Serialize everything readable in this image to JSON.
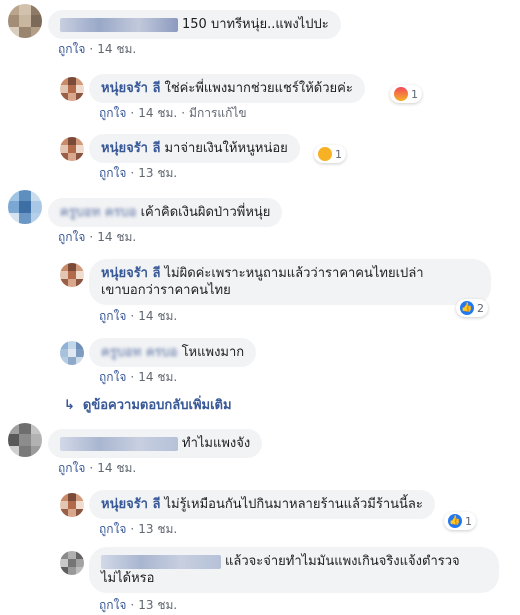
{
  "labels": {
    "like": "ถูกใจ",
    "more_replies": "ดูข้อความตอบกลับเพิ่มเติม"
  },
  "comments": [
    {
      "name": "Preeda Papang",
      "text": "150 บาทรีหนุ่ย..แพงไปปะ",
      "time": "14 ชม."
    },
    {
      "name": "หนุ่ยจรัา ลี",
      "text": "ใช่ค่ะพี่แพงมากช่วยแชร์ให้ด้วยค่ะ",
      "time": "14 ชม.",
      "edited": "มีการแก้ไข",
      "reaction": "angry",
      "count": "1"
    },
    {
      "name": "หนุ่ยจรัา ลี",
      "text": "มาจ่ายเงินให้หนูหน่อย",
      "time": "13 ชม.",
      "reaction": "haha",
      "count": "1"
    },
    {
      "name": "ครูบอท ครบอ",
      "text": "เค้าคิดเงินผิดป่าวพี่หนุ่ย",
      "time": "14 ชม."
    },
    {
      "name": "หนุ่ยจรัา ลี",
      "text1": "ไม่ผิดค่ะเพราะหนูถามแล้วว่าราคาคนไทยเปล่า",
      "text2": "เขาบอกว่าราคาคนไทย",
      "time": "14 ชม.",
      "reaction": "like",
      "count": "2"
    },
    {
      "name": "ครูบอท ครบอ",
      "text": "โหแพงมาก",
      "time": "14 ชม."
    },
    {
      "text": "ทำไมแพงจัง",
      "time": "14 ชม."
    },
    {
      "name": "หนุ่ยจรัา ลี",
      "text": "ไม่รู้เหมือนกันไปกินมาหลายร้านแล้วมีร้านนี้ละ",
      "time": "13 ชม.",
      "reaction": "like",
      "count": "1"
    },
    {
      "text1": "แล้วจะจ่ายทำไมมันแพงเกินจริงแจ้งตำรวจ",
      "text2": "ไม่ได้หรอ",
      "time": "13 ชม."
    }
  ]
}
